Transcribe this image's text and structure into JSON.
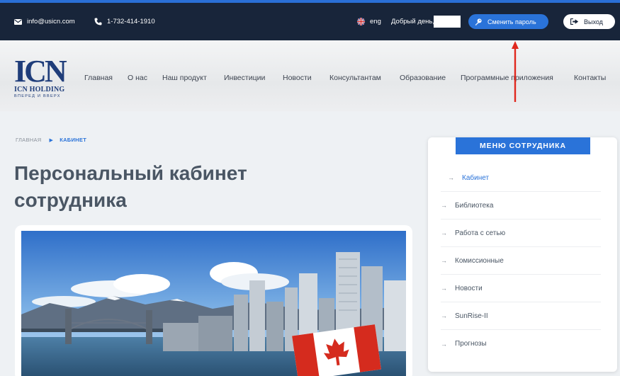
{
  "topbar": {
    "email": "info@usicn.com",
    "phone": "1-732-414-1910",
    "language": "eng",
    "greeting": "Добрый день,",
    "change_password": "Сменить пароль",
    "logout": "Выход"
  },
  "logo": {
    "mark": "ICN",
    "name": "ICN HOLDING",
    "tagline": "ВПЕРЕД И ВВЕРХ"
  },
  "nav": [
    {
      "label": "Главная"
    },
    {
      "label": "О нас"
    },
    {
      "label": "Наш продукт"
    },
    {
      "label": "Инвестиции"
    },
    {
      "label": "Новости"
    },
    {
      "label": "Консультантам"
    },
    {
      "label": "Образование"
    },
    {
      "label": "Программные приложения"
    },
    {
      "label": "Контакты"
    }
  ],
  "breadcrumb": {
    "home": "ГЛАВНАЯ",
    "current": "КАБИНЕТ"
  },
  "page_title": "Персональный кабинет сотрудника",
  "menu": {
    "title": "МЕНЮ СОТРУДНИКА",
    "items": [
      {
        "label": "Кабинет",
        "active": true
      },
      {
        "label": "Библиотека"
      },
      {
        "label": "Работа с сетью"
      },
      {
        "label": "Комиссионные"
      },
      {
        "label": "Новости"
      },
      {
        "label": "SunRise-II"
      },
      {
        "label": "Прогнозы"
      }
    ]
  },
  "colors": {
    "topbar": "#18253a",
    "accent": "#2a73d9",
    "annotation_arrow": "#e0281e"
  },
  "icons": {
    "email": "envelope-icon",
    "phone": "phone-icon",
    "language": "uk-flag-icon",
    "password": "key-icon",
    "logout": "logout-icon",
    "breadcrumb_separator": "caret-right-icon",
    "menu_item": "arrow-right-icon"
  }
}
